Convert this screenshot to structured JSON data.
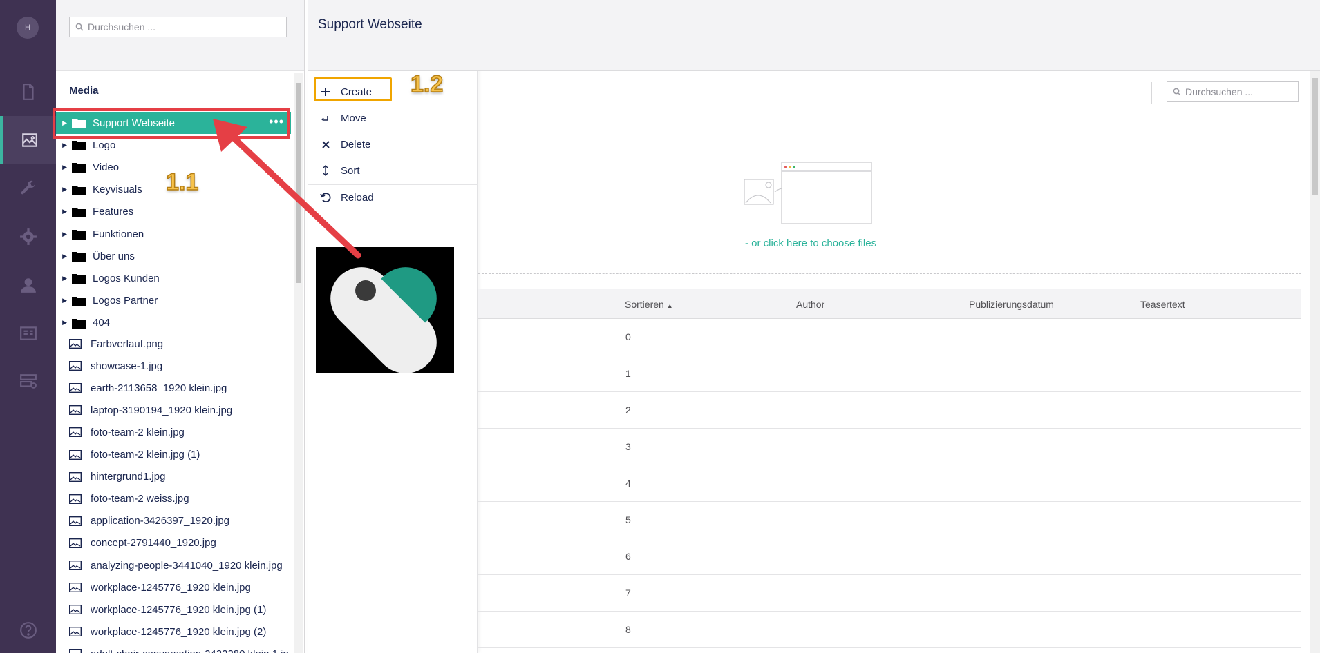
{
  "rail": {
    "avatar_initial": "H"
  },
  "tree": {
    "search_placeholder": "Durchsuchen ...",
    "title": "Media",
    "folders": [
      {
        "label": "Support Webseite",
        "selected": true
      },
      {
        "label": "Logo"
      },
      {
        "label": "Video"
      },
      {
        "label": "Keyvisuals"
      },
      {
        "label": "Features"
      },
      {
        "label": "Funktionen"
      },
      {
        "label": "Über uns"
      },
      {
        "label": "Logos Kunden"
      },
      {
        "label": "Logos Partner"
      },
      {
        "label": "404"
      }
    ],
    "files": [
      "Farbverlauf.png",
      "showcase-1.jpg",
      "earth-2113658_1920 klein.jpg",
      "laptop-3190194_1920 klein.jpg",
      "foto-team-2 klein.jpg",
      "foto-team-2 klein.jpg (1)",
      "hintergrund1.jpg",
      "foto-team-2 weiss.jpg",
      "application-3426397_1920.jpg",
      "concept-2791440_1920.jpg",
      "analyzing-people-3441040_1920 klein.jpg",
      "workplace-1245776_1920 klein.jpg",
      "workplace-1245776_1920 klein.jpg (1)",
      "workplace-1245776_1920 klein.jpg (2)",
      "adult-chair-conversation-2422280 klein 1.jp"
    ]
  },
  "actions": {
    "title": "Support Webseite",
    "items": [
      {
        "label": "Create",
        "icon": "plus-icon"
      },
      {
        "label": "Move",
        "icon": "move-icon"
      },
      {
        "label": "Delete",
        "icon": "delete-icon"
      },
      {
        "label": "Sort",
        "icon": "sort-icon"
      },
      {
        "label": "Reload",
        "icon": "reload-icon"
      }
    ]
  },
  "main": {
    "search_placeholder": "Durchsuchen ...",
    "drop_link": "- or click here to choose files",
    "columns": [
      "Sortieren",
      "Author",
      "Publizierungsdatum",
      "Teasertext"
    ],
    "rows": [
      "0",
      "1",
      "2",
      "3",
      "4",
      "5",
      "6",
      "7",
      "8"
    ]
  },
  "annotations": {
    "step1": "1.1",
    "step2": "1.2"
  },
  "colors": {
    "rail": "#3f3252",
    "accent": "#2bb39a",
    "highlight_red": "#e53f45",
    "highlight_orange": "#f0a500"
  }
}
